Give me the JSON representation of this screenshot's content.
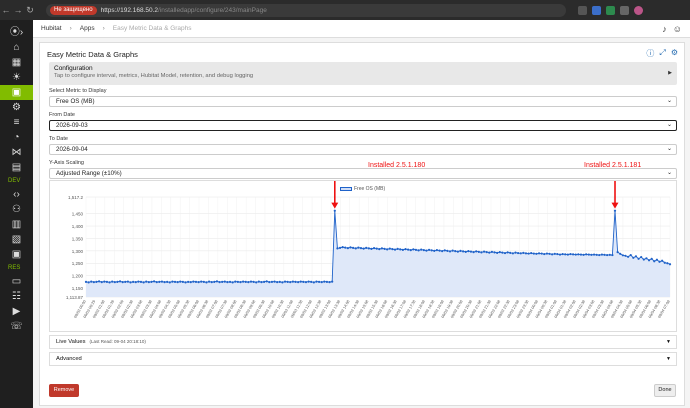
{
  "browser": {
    "security_badge": "Не защищено",
    "url_host": "https://192.168.50.2",
    "url_path": "/installedapp/configure/243/mainPage"
  },
  "sidebar": {
    "dev_label": "DEV",
    "res_label": "RES"
  },
  "topbar": {
    "crumb1": "Hubitat",
    "crumb2": "Apps",
    "crumb3": "Easy Metric Data & Graphs"
  },
  "app": {
    "title": "Easy Metric Data & Graphs",
    "configuration": {
      "title": "Configuration",
      "subtitle": "Tap to configure interval, metrics, Hubitat Model, retention, and debug logging"
    },
    "metric": {
      "label": "Select Metric to Display",
      "value": "Free OS (MB)"
    },
    "from_date": {
      "label": "From Date",
      "value": "2026-09-03"
    },
    "to_date": {
      "label": "To Date",
      "value": "2026-09-04"
    },
    "y_scaling": {
      "label": "Y-Axis Scaling",
      "value": "Adjusted Range (±10%)"
    },
    "live_values": {
      "label": "Live Values",
      "note": "(Last Read: 09-04 20:18:10)"
    },
    "advanced": {
      "label": "Advanced"
    },
    "remove_label": "Remove",
    "done_label": "Done"
  },
  "annotations": {
    "first": "Installed 2.5.1.180",
    "second": "Installed 2.5.1.181"
  },
  "chart_data": {
    "type": "area",
    "series": [
      {
        "name": "Free OS (MB)",
        "color": "#1f62c9",
        "fill": "#dfe8f9"
      }
    ],
    "ylim": [
      1113.87,
      1517.2
    ],
    "y_ticks": [
      "1,517.2",
      "1,450",
      "1,400",
      "1,350",
      "1,300",
      "1,250",
      "1,200",
      "1,150",
      "1,113.87"
    ],
    "y_tick_values": [
      1517.2,
      1450,
      1400,
      1350,
      1300,
      1250,
      1200,
      1150,
      1113.87
    ],
    "x_labels": [
      "09/03 00:00",
      "09/03 00:29",
      "09/03 01:08",
      "09/03 01:39",
      "09/03 02:09",
      "09/03 02:38",
      "09/03 03:08",
      "09/03 03:38",
      "09/03 04:08",
      "09/03 04:38",
      "09/03 05:08",
      "09/03 05:38",
      "09/03 06:08",
      "09/03 06:38",
      "09/03 07:08",
      "09/03 07:38",
      "09/03 08:08",
      "09/03 08:38",
      "09/03 09:08",
      "09/03 09:38",
      "09/03 10:08",
      "09/03 10:38",
      "09/03 11:08",
      "09/03 11:38",
      "09/03 12:08",
      "09/03 12:38",
      "09/03 13:08",
      "09/03 13:38",
      "09/03 14:08",
      "09/03 14:38",
      "09/03 15:08",
      "09/03 15:38",
      "09/03 16:08",
      "09/03 16:38",
      "09/03 17:08",
      "09/03 17:38",
      "09/03 18:08",
      "09/03 18:38",
      "09/03 19:08",
      "09/03 19:38",
      "09/03 20:08",
      "09/03 20:38",
      "09/03 21:08",
      "09/03 21:38",
      "09/03 22:08",
      "09/03 22:38",
      "09/03 23:08",
      "09/03 23:38",
      "09/04 00:08",
      "09/04 00:38",
      "09/04 01:08",
      "09/04 01:38",
      "09/04 02:08",
      "09/04 02:38",
      "09/04 03:08",
      "09/04 03:38",
      "09/04 04:08",
      "09/04 04:38",
      "09/04 05:08",
      "09/04 05:38",
      "09/04 06:08",
      "09/04 06:38",
      "09/04 07:08"
    ],
    "values": [
      1175,
      1173,
      1176,
      1174,
      1175,
      1177,
      1174,
      1176,
      1175,
      1173,
      1176,
      1174,
      1175,
      1177,
      1174,
      1175,
      1176,
      1173,
      1175,
      1174,
      1176,
      1175,
      1173,
      1176,
      1174,
      1175,
      1177,
      1174,
      1175,
      1176,
      1174,
      1175,
      1173,
      1176,
      1175,
      1174,
      1176,
      1175,
      1173,
      1175,
      1174,
      1176,
      1175,
      1174,
      1176,
      1175,
      1173,
      1176,
      1174,
      1175,
      1177,
      1174,
      1175,
      1176,
      1174,
      1175,
      1173,
      1176,
      1175,
      1174,
      1176,
      1175,
      1174,
      1176,
      1175,
      1173,
      1176,
      1174,
      1175,
      1177,
      1174,
      1175,
      1176,
      1174,
      1175,
      1173,
      1176,
      1175,
      1174,
      1176,
      1175,
      1174,
      1176,
      1175,
      1174,
      1176,
      1175,
      1173,
      1176,
      1175,
      1174,
      1176,
      1175,
      1174,
      1176,
      1462,
      1310,
      1312,
      1315,
      1313,
      1311,
      1314,
      1312,
      1310,
      1313,
      1311,
      1309,
      1312,
      1310,
      1308,
      1311,
      1309,
      1307,
      1310,
      1308,
      1306,
      1309,
      1307,
      1305,
      1308,
      1306,
      1304,
      1307,
      1305,
      1303,
      1306,
      1304,
      1302,
      1305,
      1303,
      1301,
      1304,
      1302,
      1300,
      1303,
      1301,
      1299,
      1302,
      1300,
      1298,
      1301,
      1299,
      1297,
      1300,
      1298,
      1296,
      1299,
      1297,
      1295,
      1298,
      1296,
      1294,
      1297,
      1295,
      1293,
      1296,
      1294,
      1292,
      1295,
      1293,
      1291,
      1294,
      1292,
      1290,
      1293,
      1291,
      1290,
      1292,
      1290,
      1289,
      1291,
      1289,
      1288,
      1290,
      1289,
      1287,
      1289,
      1288,
      1286,
      1288,
      1287,
      1285,
      1287,
      1286,
      1285,
      1287,
      1286,
      1285,
      1286,
      1285,
      1284,
      1286,
      1285,
      1284,
      1285,
      1284,
      1283,
      1285,
      1284,
      1283,
      1284,
      1283,
      1462,
      1295,
      1288,
      1282,
      1280,
      1276,
      1283,
      1272,
      1278,
      1268,
      1275,
      1265,
      1270,
      1262,
      1268,
      1258,
      1264,
      1256,
      1260,
      1252,
      1250,
      1246
    ],
    "grid": true,
    "legend_position": "top-center"
  }
}
